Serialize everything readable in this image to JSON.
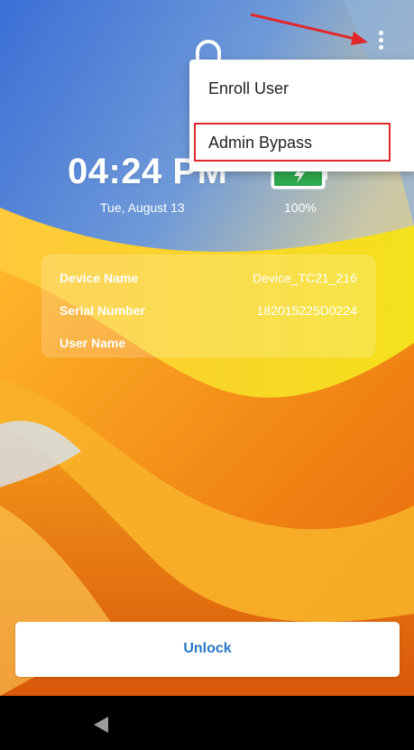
{
  "lockscreen": {
    "time": "04:24 PM",
    "date": "Tue, August 13",
    "battery_percent": "100%",
    "battery_level": 1.0
  },
  "device_info": {
    "rows": [
      {
        "label": "Device Name",
        "value": "Device_TC21_216"
      },
      {
        "label": "Serial Number",
        "value": "182015225D0224"
      },
      {
        "label": "User Name",
        "value": ""
      }
    ]
  },
  "overflow_menu": {
    "items": [
      {
        "label": "Enroll User"
      },
      {
        "label": "Admin Bypass",
        "highlighted": true
      }
    ]
  },
  "unlock_button": {
    "label": "Unlock"
  },
  "icons": {
    "lock": "lock-icon",
    "battery": "battery-icon",
    "overflow": "more-vert-icon",
    "back": "back-icon"
  },
  "colors": {
    "accent_blue": "#2a78c6",
    "highlight_red": "#e0282b",
    "battery_green": "#2fa84f",
    "nav_bar": "#000000"
  }
}
